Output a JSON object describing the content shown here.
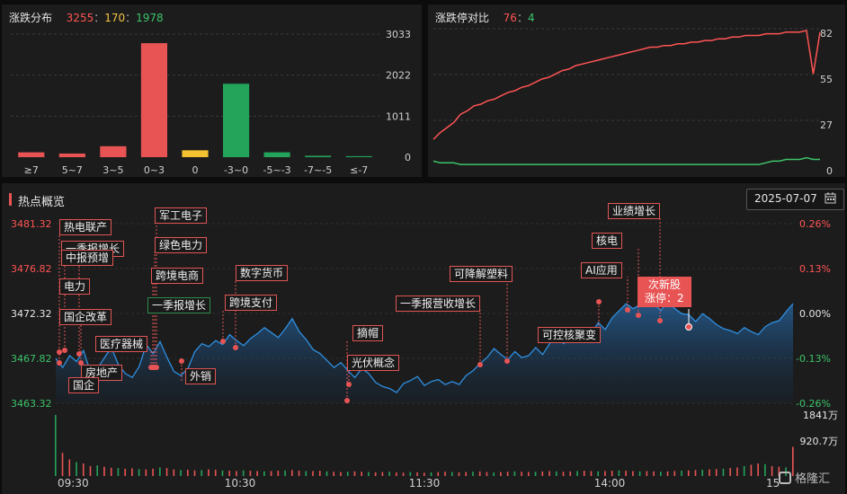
{
  "distribution": {
    "title": "涨跌分布",
    "up": "3255",
    "flat": "170",
    "down": "1978",
    "sep": "：",
    "y_ticks": [
      "3033",
      "2022",
      "1011",
      "0"
    ],
    "chart_data": {
      "type": "bar",
      "categories": [
        "≥7",
        "5~7",
        "3~5",
        "0~3",
        "0",
        "-3~0",
        "-5~-3",
        "-7~-5",
        "≤-7"
      ],
      "values": [
        120,
        90,
        270,
        2810,
        170,
        1810,
        120,
        35,
        25
      ],
      "ylim": [
        0,
        3033
      ],
      "colors": [
        "#e85454",
        "#e85454",
        "#e85454",
        "#e85454",
        "#f2c230",
        "#24a35a",
        "#24a35a",
        "#24a35a",
        "#24a35a"
      ]
    }
  },
  "limit": {
    "title": "涨跌停对比",
    "up": "76",
    "down": "4",
    "sep": "：",
    "y_ticks": [
      "82",
      "55",
      "27",
      "0"
    ],
    "chart_data": {
      "type": "line",
      "ylim": [
        0,
        82
      ],
      "series": [
        {
          "color": "#ff5454",
          "values": [
            16,
            20,
            23,
            26,
            31,
            33,
            36,
            37,
            39,
            40,
            42,
            44,
            45,
            47,
            48,
            50,
            52,
            53,
            55,
            57,
            58,
            60,
            61,
            62,
            63,
            64,
            65,
            66,
            67,
            68,
            69,
            70,
            71,
            71,
            72,
            72,
            73,
            73,
            74,
            74,
            75,
            75,
            76,
            76,
            77,
            77,
            78,
            78,
            78,
            79,
            79,
            79,
            80,
            80,
            80,
            81,
            55,
            80
          ]
        },
        {
          "color": "#3cc46a",
          "values": [
            3,
            2,
            2,
            2,
            1,
            1,
            1,
            1,
            1,
            1,
            1,
            1,
            1,
            1,
            1,
            1,
            1,
            1,
            1,
            1,
            1,
            1,
            1,
            1,
            1,
            1,
            1,
            1,
            1,
            1,
            1,
            1,
            1,
            1,
            1,
            1,
            1,
            1,
            1,
            1,
            1,
            1,
            1,
            1,
            1,
            1,
            1,
            1,
            1,
            2,
            3,
            3,
            4,
            4,
            4,
            5,
            4,
            4
          ]
        }
      ]
    }
  },
  "hot": {
    "title": "热点概览",
    "date": "2025-07-07",
    "calendar_icon": "calendar-icon",
    "y_left": [
      "3481.32",
      "3476.82",
      "3472.32",
      "3467.82",
      "3463.32"
    ],
    "y_right": [
      "0.26%",
      "0.13%",
      "0.00%",
      "-0.13%",
      "-0.26%"
    ],
    "vol_labels": [
      "1841万",
      "920.7万"
    ],
    "x_labels": [
      "09:30",
      "10:30",
      "11:30",
      "14:00",
      "15"
    ],
    "watermark": "格隆汇",
    "popup": {
      "line1": "次新股",
      "line2": "涨停：2"
    },
    "tags": [
      {
        "text": "热电联产",
        "g": false
      },
      {
        "text": "一季报增长",
        "g": false
      },
      {
        "text": "中报预增",
        "g": false
      },
      {
        "text": "电力",
        "g": false
      },
      {
        "text": "国企改革",
        "g": false
      },
      {
        "text": "医疗器械",
        "g": false
      },
      {
        "text": "房地产",
        "g": false
      },
      {
        "text": "国企",
        "g": false
      },
      {
        "text": "军工电子",
        "g": false
      },
      {
        "text": "绿色电力",
        "g": false
      },
      {
        "text": "跨境电商",
        "g": false
      },
      {
        "text": "一季报增长",
        "g": true
      },
      {
        "text": "外销",
        "g": false
      },
      {
        "text": "数字货币",
        "g": false
      },
      {
        "text": "跨境支付",
        "g": false
      },
      {
        "text": "摘帽",
        "g": false
      },
      {
        "text": "光伏概念",
        "g": false
      },
      {
        "text": "可降解塑料",
        "g": false
      },
      {
        "text": "一季报营收增长",
        "g": false
      },
      {
        "text": "可控核聚变",
        "g": false
      },
      {
        "text": "AI应用",
        "g": false
      },
      {
        "text": "核电",
        "g": false
      },
      {
        "text": "业绩增长",
        "g": false
      }
    ],
    "chart_data": {
      "type": "area",
      "ylim": [
        3463.32,
        3481.32
      ],
      "values": [
        3467.8,
        3466.9,
        3468.1,
        3467.5,
        3468.6,
        3466.4,
        3466.8,
        3467.9,
        3468.9,
        3467.2,
        3466.3,
        3465.9,
        3467.0,
        3469.2,
        3468.3,
        3469.5,
        3467.9,
        3466.5,
        3466.1,
        3466.8,
        3468.5,
        3469.3,
        3469.0,
        3469.6,
        3469.2,
        3470.2,
        3469.6,
        3469.1,
        3469.8,
        3470.3,
        3470.9,
        3470.4,
        3469.9,
        3470.8,
        3471.8,
        3470.5,
        3469.7,
        3468.7,
        3468.3,
        3467.6,
        3466.9,
        3467.4,
        3466.6,
        3465.9,
        3466.8,
        3466.3,
        3465.4,
        3465.0,
        3464.8,
        3464.4,
        3465.3,
        3465.6,
        3466.0,
        3465.1,
        3465.5,
        3465.7,
        3465.2,
        3465.5,
        3465.2,
        3466.1,
        3466.6,
        3467.3,
        3467.9,
        3468.8,
        3468.2,
        3467.7,
        3468.5,
        3467.9,
        3468.1,
        3468.9,
        3468.2,
        3469.3,
        3470.2,
        3469.3,
        3469.8,
        3470.6,
        3470.0,
        3470.3,
        3471.4,
        3470.7,
        3471.9,
        3472.6,
        3473.3,
        3472.8,
        3473.2,
        3473.9,
        3473.3,
        3472.6,
        3473.6,
        3472.8,
        3472.3,
        3472.2,
        3471.5,
        3472.3,
        3471.8,
        3471.2,
        3470.8,
        3470.6,
        3470.3,
        3470.9,
        3470.5,
        3470.2,
        3471.0,
        3471.4,
        3471.6,
        3472.5,
        3473.3
      ]
    },
    "volume": [
      1841,
      700,
      500,
      420,
      380,
      300,
      320,
      280,
      250,
      240,
      220,
      230,
      210,
      200,
      220,
      260,
      240,
      200,
      180,
      190,
      170,
      180,
      200,
      190,
      170,
      160,
      150,
      170,
      160,
      150,
      140,
      150,
      160,
      170,
      180,
      160,
      150,
      150,
      160,
      140,
      130,
      120,
      130,
      140,
      130,
      120,
      110,
      120,
      130,
      110,
      100,
      120,
      110,
      100,
      110,
      120,
      130,
      120,
      110,
      120,
      130,
      140,
      120,
      110,
      120,
      130,
      140,
      130,
      120,
      130,
      140,
      150,
      140,
      130,
      140,
      150,
      160,
      150,
      140,
      150,
      160,
      170,
      160,
      150,
      140,
      150,
      140,
      130,
      140,
      150,
      160,
      170,
      180,
      190,
      200,
      210,
      220,
      240,
      260,
      300,
      340,
      380,
      360,
      300,
      280,
      260,
      880
    ]
  }
}
